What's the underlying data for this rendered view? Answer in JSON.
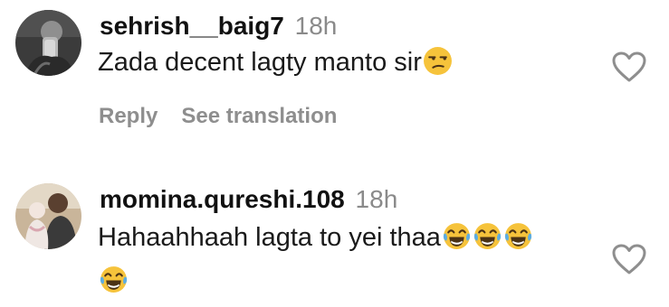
{
  "comments": [
    {
      "username": "sehrish__baig7",
      "time": "18h",
      "text": "Zada decent lagty manto sir",
      "emojis": [
        "unamused-face-emoji"
      ],
      "actions": {
        "reply": "Reply",
        "translate": "See translation"
      },
      "like_icon": "heart-outline-icon"
    },
    {
      "username": "momina.qureshi.108",
      "time": "18h",
      "text": "Hahaahhaah lagta to yei thaa",
      "emojis": [
        "tears-of-joy-emoji",
        "tears-of-joy-emoji",
        "tears-of-joy-emoji",
        "tears-of-joy-emoji"
      ],
      "like_icon": "heart-outline-icon"
    }
  ],
  "colors": {
    "username": "#111111",
    "timestamp": "#8a8a8a",
    "action_text": "#8e8e8e",
    "emoji_yellow": "#f6c33b",
    "tear_blue": "#5dade2"
  }
}
